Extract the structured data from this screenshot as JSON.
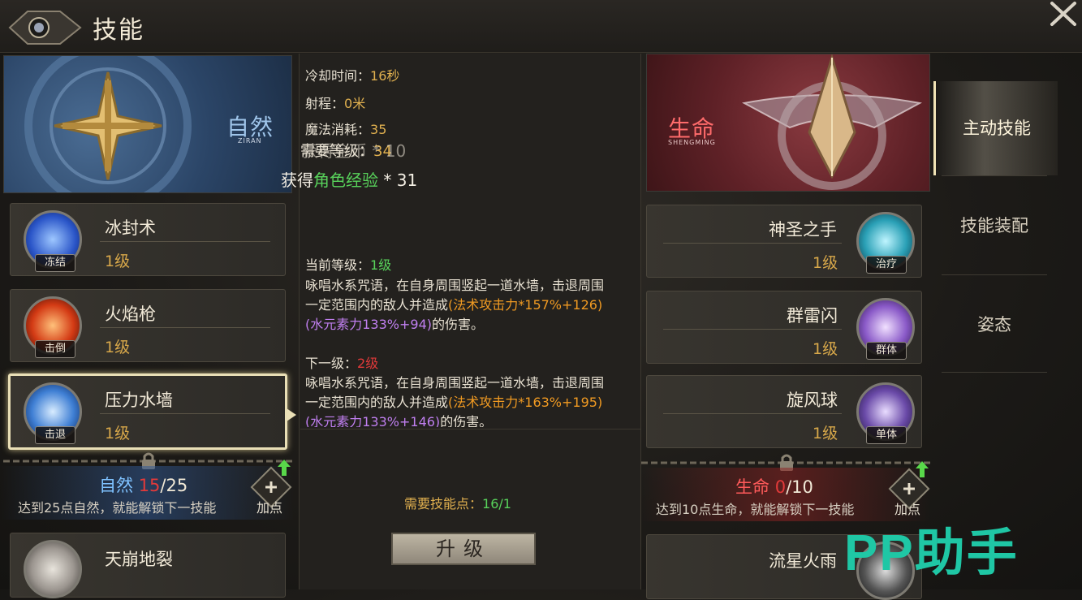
{
  "header": {
    "title": "技能"
  },
  "left_school": {
    "name": "自然",
    "sub": "ZIRAN"
  },
  "right_school": {
    "name": "生命",
    "sub": "SHENGMING"
  },
  "left_skills": [
    {
      "name": "冰封术",
      "level": "1级",
      "tag": "冻结"
    },
    {
      "name": "火焰枪",
      "level": "1级",
      "tag": "击倒"
    },
    {
      "name": "压力水墙",
      "level": "1级",
      "tag": "击退"
    },
    {
      "name": "天崩地裂"
    }
  ],
  "right_skills": [
    {
      "name": "神圣之手",
      "level": "1级",
      "tag": "治疗"
    },
    {
      "name": "群雷闪",
      "level": "1级",
      "tag": "群体"
    },
    {
      "name": "旋风球",
      "level": "1级",
      "tag": "单体"
    },
    {
      "name": "流星火雨"
    }
  ],
  "left_points": {
    "school": "自然",
    "current": "15",
    "total": "/25",
    "hint": "达到25点自然，就能解锁下一技能",
    "add_label": "加点"
  },
  "right_points": {
    "school": "生命",
    "current": "0",
    "total": "/10",
    "hint": "达到10点生命，就能解锁下一技能",
    "add_label": "加点"
  },
  "detail": {
    "cooldown_label": "冷却时间：",
    "cooldown_value": "16秒",
    "range_label": "射程：",
    "range_value": "0米",
    "mana_label": "魔法消耗：",
    "mana_value": "35",
    "req_label": "需要等级：",
    "req_value": "34",
    "reward_coin": "获得金币 * 10",
    "reward_exp_label": "获得",
    "reward_exp_name": "角色经验",
    "reward_exp_value": " * 31",
    "current_level_label": "当前等级：",
    "current_level_value": "1级",
    "current_desc_1": "咏唱水系咒语，在自身周围竖起一道水墙，击退周围一定范围内的敌人并造成",
    "current_desc_2": "(法术攻击力*157%+126)",
    "current_desc_3": "(水元素力133%+94)",
    "current_desc_4": "的伤害。",
    "next_level_label": "下一级：",
    "next_level_value": "2级",
    "next_desc_1": "咏唱水系咒语，在自身周围竖起一道水墙，击退周围一定范围内的敌人并造成",
    "next_desc_2": "(法术攻击力*163%+195)",
    "next_desc_3": "(水元素力133%+146)",
    "next_desc_4": "的伤害。",
    "skill_points_label": "需要技能点：",
    "skill_points_value": "16/1",
    "upgrade_label": "升级"
  },
  "tabs": [
    {
      "label": "主动技能",
      "active": true
    },
    {
      "label": "技能装配",
      "active": false
    },
    {
      "label": "姿态",
      "active": false
    }
  ],
  "watermark": "PP助手"
}
